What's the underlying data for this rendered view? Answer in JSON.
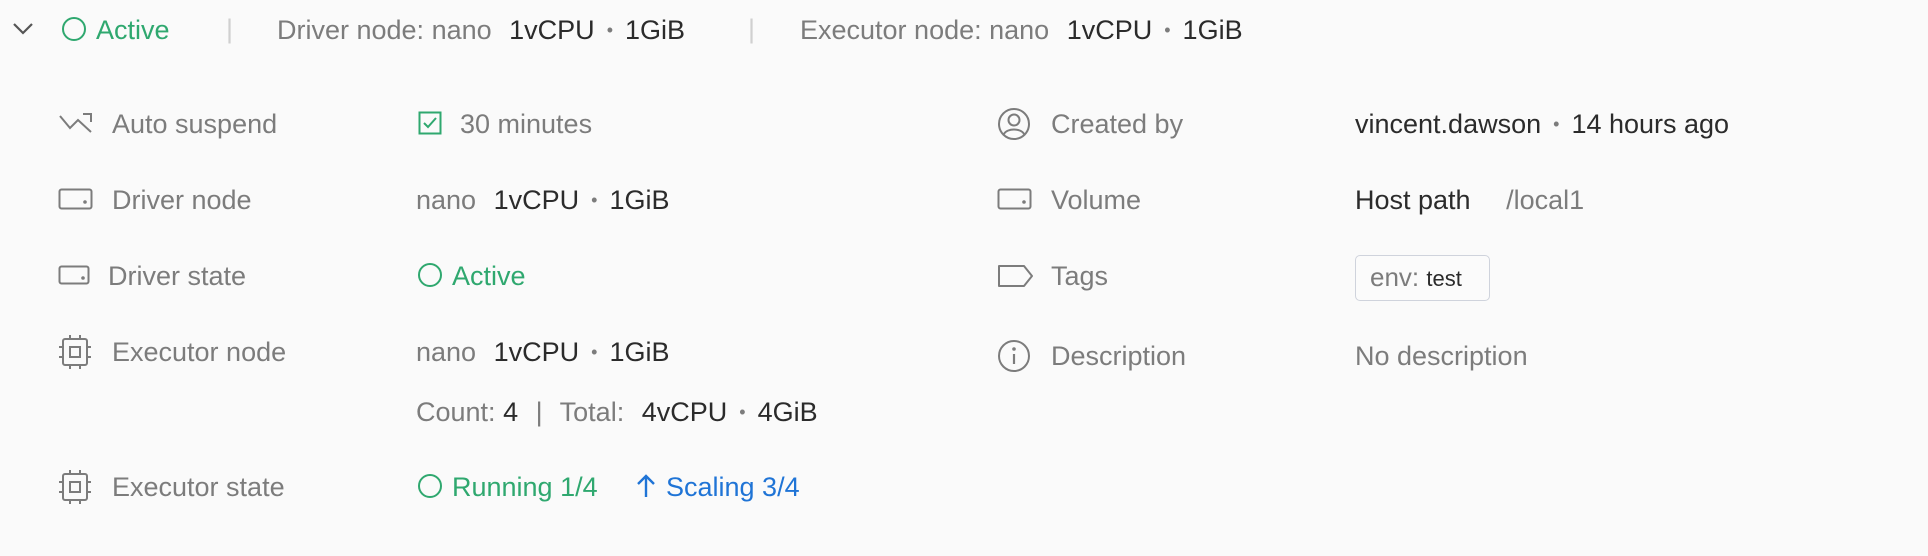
{
  "header": {
    "status": "Active",
    "driver_label": "Driver node: nano",
    "driver_cpu": "1vCPU",
    "driver_mem": "1GiB",
    "executor_label": "Executor node: nano",
    "executor_cpu": "1vCPU",
    "executor_mem": "1GiB"
  },
  "left": {
    "auto_suspend": {
      "label": "Auto suspend",
      "value": "30 minutes"
    },
    "driver_node": {
      "label": "Driver node",
      "size": "nano",
      "cpu": "1vCPU",
      "mem": "1GiB"
    },
    "driver_state": {
      "label": "Driver state",
      "value": "Active"
    },
    "executor_node": {
      "label": "Executor node",
      "size": "nano",
      "cpu": "1vCPU",
      "mem": "1GiB",
      "count_label": "Count:",
      "count": "4",
      "total_label": "Total:",
      "total_cpu": "4vCPU",
      "total_mem": "4GiB"
    },
    "executor_state": {
      "label": "Executor state",
      "running": "Running 1/4",
      "scaling": "Scaling 3/4"
    }
  },
  "right": {
    "created_by": {
      "label": "Created by",
      "user": "vincent.dawson",
      "time": "14 hours ago"
    },
    "volume": {
      "label": "Volume",
      "type": "Host path",
      "path": "/local1"
    },
    "tags": {
      "label": "Tags",
      "key": "env:",
      "value": "test"
    },
    "description": {
      "label": "Description",
      "value": "No description"
    }
  },
  "colors": {
    "green": "#2fa86f",
    "blue": "#1f74d6",
    "muted": "#7c7c7c",
    "text": "#2b2b2b"
  },
  "icons": [
    "chevron-down-icon",
    "auto-suspend-icon",
    "checkbox-icon",
    "server-icon",
    "chip-icon",
    "user-icon",
    "tag-icon",
    "info-icon",
    "arrow-up-icon"
  ]
}
